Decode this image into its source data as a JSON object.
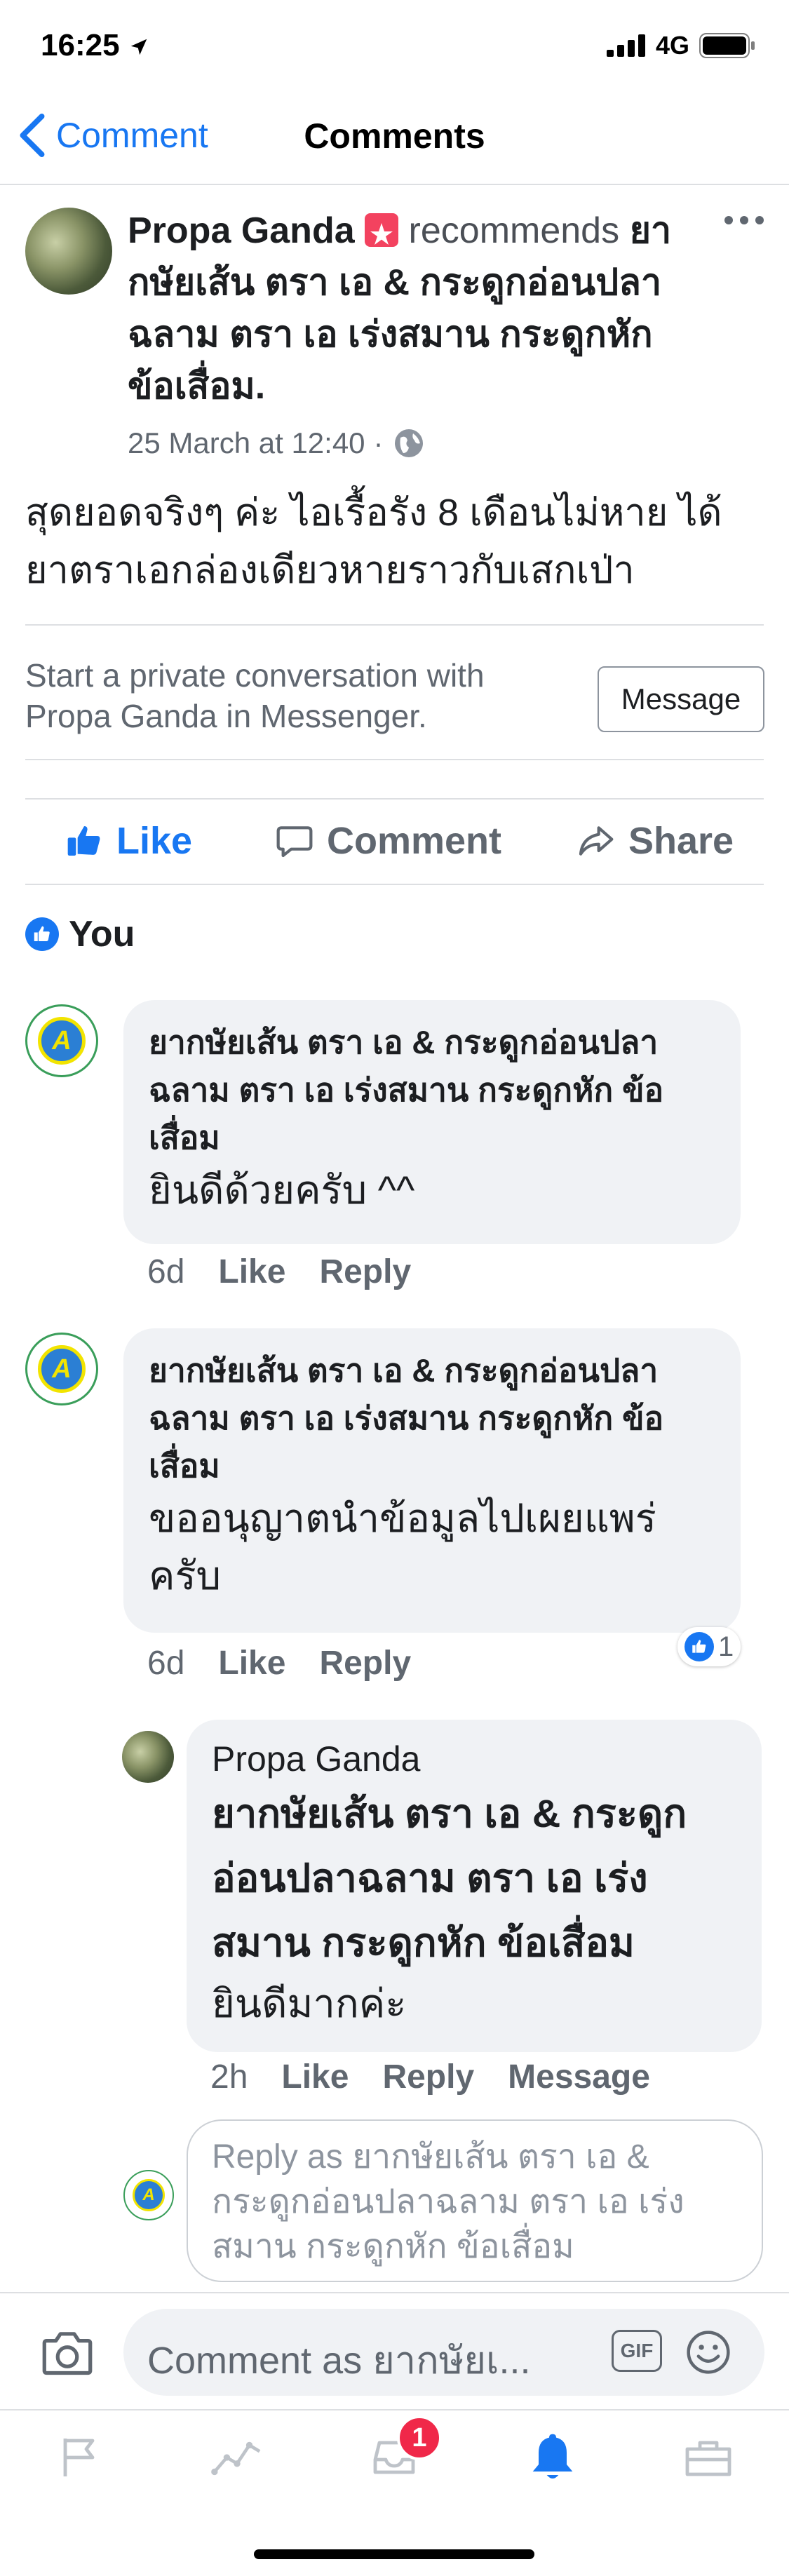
{
  "status": {
    "time": "16:25",
    "network": "4G"
  },
  "nav": {
    "back_label": "Comment",
    "title": "Comments"
  },
  "post": {
    "author": "Propa Ganda",
    "action": "recommends",
    "page": "ยากษัยเส้น ตรา เอ & กระดูกอ่อนปลาฉลาม ตรา เอ เร่งสมาน กระดูกหัก ข้อเสื่อม.",
    "timestamp": "25 March at 12:40",
    "text": "สุดยอดจริงๆ ค่ะ ไอเรื้อรัง 8 เดือนไม่หาย ได้ยาตราเอกล่องเดียวหายราวกับเสกเป่า"
  },
  "messenger": {
    "prompt": "Start a private conversation with Propa Ganda in Messenger.",
    "button": "Message"
  },
  "actions": {
    "like": "Like",
    "comment": "Comment",
    "share": "Share"
  },
  "reactions": {
    "label": "You"
  },
  "comments": [
    {
      "author": "ยากษัยเส้น ตรา เอ & กระดูกอ่อนปลาฉลาม ตรา เอ เร่งสมาน กระดูกหัก ข้อเสื่อม",
      "text": "ยินดีด้วยครับ  ^^",
      "time": "6d",
      "like": "Like",
      "reply": "Reply"
    },
    {
      "author": "ยากษัยเส้น ตรา เอ & กระดูกอ่อนปลาฉลาม ตรา เอ เร่งสมาน กระดูกหัก ข้อเสื่อม",
      "text": "ขออนุญาตนำข้อมูลไปเผยแพร่ครับ",
      "time": "6d",
      "like": "Like",
      "reply": "Reply",
      "reaction_count": "1"
    }
  ],
  "reply": {
    "author": "Propa Ganda",
    "mention": "ยากษัยเส้น ตรา เอ & กระดูกอ่อนปลาฉลาม ตรา เอ เร่งสมาน กระดูกหัก ข้อเสื่อม",
    "text": "ยินดีมากค่ะ",
    "time": "2h",
    "like": "Like",
    "reply": "Reply",
    "message": "Message"
  },
  "reply_input": {
    "placeholder": "Reply as ยากษัยเส้น ตรา เอ & กระดูกอ่อนปลาฉลาม ตรา เอ เร่งสมาน กระดูกหัก ข้อเสื่อม"
  },
  "composer": {
    "placeholder": "Comment as ยากษัยเ...",
    "gif_label": "GIF"
  },
  "tabbar": {
    "notifications_badge": "1"
  },
  "colors": {
    "accent": "#1877f2",
    "badge": "#f02849",
    "bubble": "#f0f2f5"
  }
}
